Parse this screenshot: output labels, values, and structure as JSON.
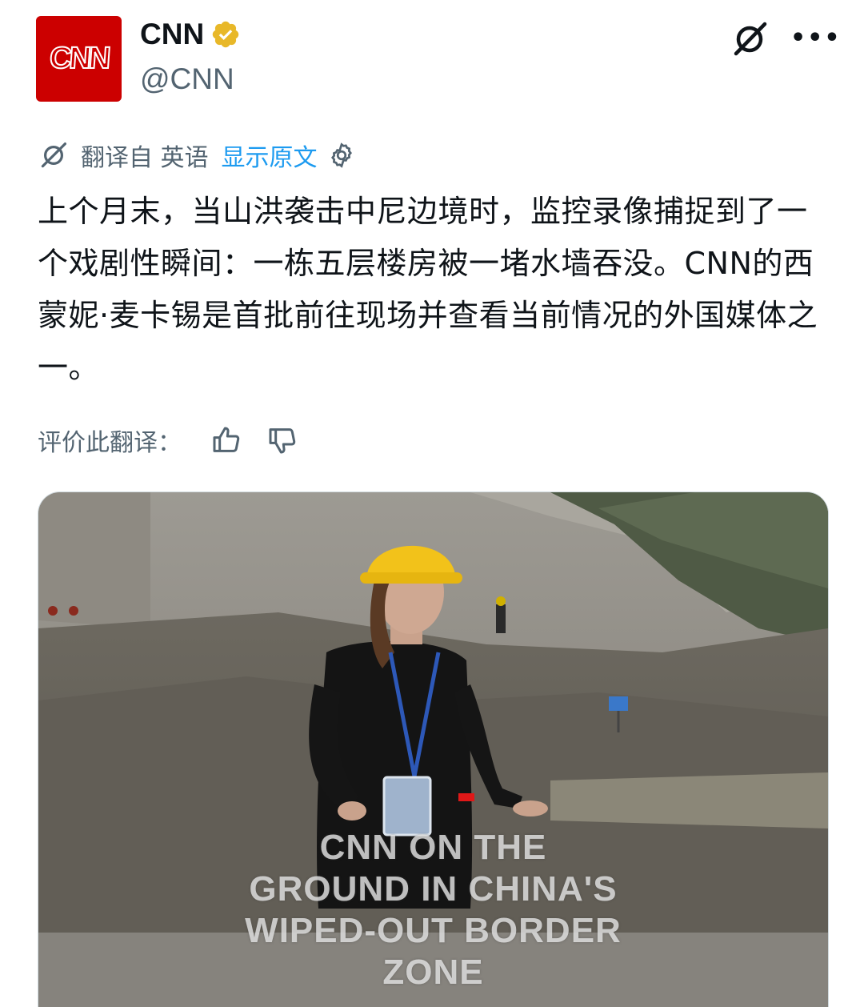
{
  "author": {
    "avatar_logo": "CNN",
    "display_name": "CNN",
    "handle": "@CNN",
    "verified_color": "#e8b829"
  },
  "header_icons": [
    "grok-icon",
    "more-icon"
  ],
  "more_label": "•••",
  "translation": {
    "from_label": "翻译自 英语",
    "show_original": "显示原文"
  },
  "tweet_text": "上个月末，当山洪袭击中尼边境时，监控录像捕捉到了一个戏剧性瞬间：一栋五层楼房被一堵水墙吞没。CNN的西蒙妮·麦卡锡是首批前往现场并查看当前情况的外国媒体之一。",
  "rate": {
    "label": "评价此翻译："
  },
  "media": {
    "caption_line1": "CNN ON THE",
    "caption_line2": "GROUND IN CHINA'S",
    "caption_line3": "WIPED-OUT BORDER",
    "caption_line4": "ZONE"
  },
  "colors": {
    "accent": "#1d9bf0",
    "brand_red": "#cc0000",
    "text": "#0f1419",
    "secondary": "#536471"
  }
}
